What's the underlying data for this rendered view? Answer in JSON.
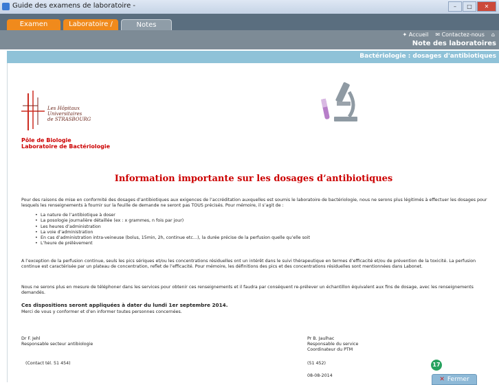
{
  "window": {
    "title": "Guide des examens de laboratoire -",
    "controls": [
      "–",
      "□",
      "✕"
    ]
  },
  "tabs": [
    {
      "label": "Examen"
    },
    {
      "label": "Laboratoire / UF"
    },
    {
      "label": "Notes"
    }
  ],
  "header": {
    "links": {
      "home": "Accueil",
      "contact": "Contactez-nous"
    },
    "section": "Note des laboratoires"
  },
  "breadcrumb": "Bactériologie : dosages d'antibiotiques",
  "logo": {
    "line1": "Les Hôpitaux",
    "line2": "Universitaires",
    "line3": "de STRASBOURG"
  },
  "org": {
    "line1": "Pôle de Biologie",
    "line2": "Laboratoire de Bactériologie"
  },
  "headline": "Information importante sur les dosages d’antibiotiques",
  "intro": "Pour des raisons de mise en conformité des dosages d’antibiotiques aux exigences de l’accréditation auxquelles est soumis le laboratoire de bactériologie, nous ne serons plus légitimés à effectuer les dosages pour lesquels les renseignements à fournir sur la feuille de demande ne seront pas TOUS précisés. Pour mémoire, il s’agit de :",
  "bullets": [
    "La nature de l’antibiotique à doser",
    "La posologie journalière détaillée (ex : x grammes, n fois par jour)",
    "Les heures d’administration",
    "La voie d’administration",
    "En cas d’administration intra-veineuse (bolus, 15min, 2h, continue etc…), la durée précise de la perfusion quelle qu’elle soit",
    "L’heure de prélèvement"
  ],
  "para2": "A l’exception de la perfusion continue, seuls les pics sériques et/ou les concentrations résiduelles ont un intérêt dans le suivi thérapeutique en termes d’efficacité et/ou de prévention de la toxicité. La perfusion continue est caractérisée par un plateau de concentration, reflet de l’efficacité. Pour mémoire, les définitions des pics et des concentrations résiduelles sont mentionnées dans Labonet.",
  "para3": "Nous ne serons plus en mesure de téléphoner dans les services pour obtenir ces renseignements et il faudra par conséquent re-prélever un échantillon équivalent aux fins de dosage, avec les renseignements demandés.",
  "notice_bold": "Ces dispositions seront appliquées à dater du lundi 1er septembre 2014.",
  "notice_sub": "Merci de vous y conformer et d’en informer toutes personnes concernées.",
  "signatures": {
    "left": {
      "name": "Dr F. Jehl",
      "role": "Responsable secteur antibiologie",
      "contact": "(Contact tél. 51 454)"
    },
    "right": {
      "name": "Pr B. Jaulhac",
      "role1": "Responsable du service",
      "role2": "Coordinateur du PTM",
      "phone": "(51 452)",
      "date": "08-08-2014"
    }
  },
  "badge": "17",
  "close_label": "Fermer",
  "colors": {
    "accent_orange": "#f08a1c",
    "band_blue": "#8fc2d8",
    "alert_red": "#cc0000",
    "badge_green": "#27a25f"
  }
}
